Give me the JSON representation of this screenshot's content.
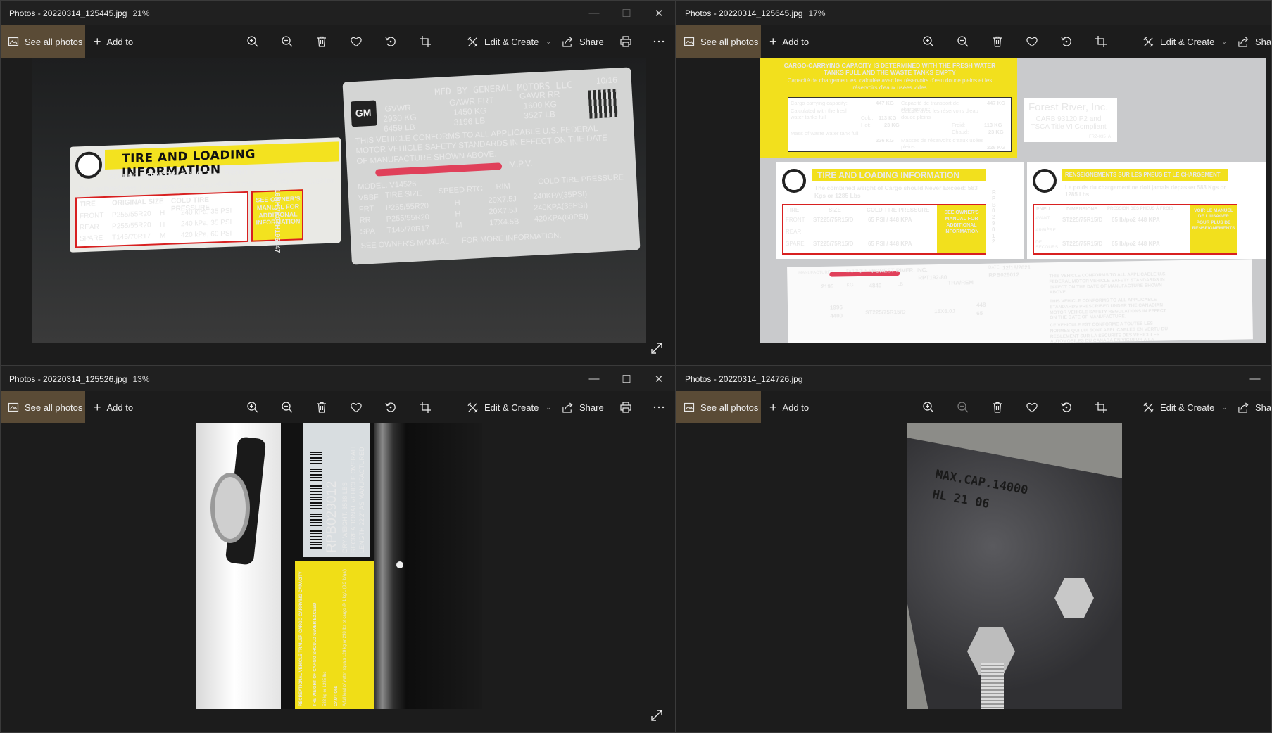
{
  "windows": [
    {
      "title": "Photos - 20220314_125445.jpg",
      "zoom": "21%",
      "toolbar": {
        "see_all": "See all photos",
        "add_to": "Add to",
        "edit_create": "Edit & Create",
        "share": "Share"
      },
      "photo": {
        "tire_header": "TIRE AND LOADING INFORMATION",
        "seating": "SEATING CAPACITY",
        "total": "TOTAL 7",
        "front": "FRONT 2",
        "rear": "REAR 5",
        "combined": "The combined weight of occupants and cargo should never exceed  584 kg or 1288 lbs.",
        "col_tire": "TIRE",
        "col_orig": "ORIGINAL SIZE",
        "col_cold": "COLD TIRE PRESSURE",
        "see_owner": "SEE OWNER'S MANUAL FOR ADDITIONAL INFORMATION",
        "rows": [
          {
            "pos": "FRONT",
            "size": "P255/55R20",
            "rt": "H",
            "p": "240 kPa, 35 PSI"
          },
          {
            "pos": "REAR",
            "size": "P255/55R20",
            "rt": "H",
            "p": "240 kPa, 35 PSI"
          },
          {
            "pos": "SPARE",
            "size": "T145/70R17",
            "rt": "M",
            "p": "420 kPa, 60 PSI"
          }
        ],
        "vin_side": "16NKVK07H196547",
        "gm": "GM",
        "mfd": "MFD BY GENERAL MOTORS LLC",
        "date": "10/16",
        "gvwr": "GVWR",
        "gawr_frt": "GAWR FRT",
        "gawr_rr": "GAWR RR",
        "kg1": "2930 KG",
        "lb1": "6459 LB",
        "kg2": "1450 KG",
        "lb2": "3196 LB",
        "kg3": "1600 KG",
        "lb3": "3527 LB",
        "conform": "THIS VEHICLE CONFORMS TO ALL APPLICABLE U.S. FEDERAL MOTOR VEHICLE SAFETY STANDARDS IN EFFECT ON THE DATE OF MANUFACTURE SHOWN ABOVE.",
        "type": "M.P.V.",
        "model": "MODEL: V14526",
        "vbbf": "VBBF",
        "tire_size": "TIRE SIZE",
        "speed_rtg": "SPEED RTG",
        "rim": "RIM",
        "cold": "COLD TIRE PRESSURE",
        "spec_rows": [
          {
            "pos": "FRT",
            "size": "P255/55R20",
            "rt": "H",
            "rim": "20X7.5J",
            "p": "240KPA(35PSI)"
          },
          {
            "pos": "RR",
            "size": "P255/55R20",
            "rt": "H",
            "rim": "20X7.5J",
            "p": "240KPA(35PSI)"
          },
          {
            "pos": "SPA",
            "size": "T145/70R17",
            "rt": "M",
            "rim": "17X4.5B",
            "p": "420KPA(60PSI)"
          }
        ],
        "see_more": "SEE OWNER'S MANUAL      FOR MORE INFORMATION."
      }
    },
    {
      "title": "Photos - 20220314_125645.jpg",
      "zoom": "17%",
      "toolbar": {
        "see_all": "See all photos",
        "add_to": "Add to",
        "edit_create": "Edit & Create",
        "share": "Shar"
      },
      "photo": {
        "top_text": "CARGO-CARRYING CAPACITY IS DETERMINED WITH THE FRESH WATER TANKS FULL AND THE WASTE TANKS EMPTY",
        "fr_text": "Capacité de chargement est calculée avec les réservoirs d'eau douce pleins et les réservoirs d'eaux usées vides",
        "cargo_cap": "Cargo carrying capacity:",
        "cargo_val": "447 KG",
        "cap_fr": "Capacité de transport de chargement:",
        "cap_fr_val": "447 KG",
        "calc": "Calculated with the fresh water tanks full",
        "cold_lbl": "Cold:",
        "cold_val": "113 KG",
        "hot_lbl": "Hot:",
        "hot_val": "23 KG",
        "calc_fr": "Calculé avec les réservoirs d'eau douce pleins",
        "froid": "Froid:",
        "froid_val": "113 KG",
        "chaud": "Chaud:",
        "chaud_val": "23 KG",
        "waste": "Mass of waste water tank full:",
        "waste_val": "226 KG",
        "waste_fr": "Masses de réservoirs d'eaux usées pleins:",
        "waste_fr_val": "226 KG",
        "fr_brand": "Forest River, Inc.",
        "carb": "CARB 93120 P2 and TSCA Title VI Compliant",
        "frz": "FRZ-035_A",
        "tire_header": "TIRE AND LOADING INFORMATION",
        "combined": "The combined weight of Cargo should Never Exceed: 583 Kgs or 1285 Lbs",
        "col_tire": "TIRE",
        "col_size": "SIZE",
        "col_cold": "COLD TIRE PRESSURE",
        "see_owner": "SEE OWNER'S MANUAL FOR ADDITIONAL INFORMATION",
        "rows": [
          {
            "pos": "FRONT",
            "size": "ST225/75R15/D",
            "p": "65 PSI / 448 KPA"
          },
          {
            "pos": "REAR",
            "size": "",
            "p": ""
          },
          {
            "pos": "SPARE",
            "size": "ST225/75R15/D",
            "p": "65 PSI / 448 KPA"
          }
        ],
        "vert": "RPB029012",
        "fr_header": "RENSEIGNEMENTS SUR LES PNEUS ET LE CHARGEMENT",
        "fr_combined": "Le poids du chargement ne doit jamais depasser 583 Kgs or 1285 Lbs",
        "fr_col_pneu": "PNEU",
        "fr_col_dim": "DIMENSIONS",
        "fr_col_pression": "PRESSION DES PNEUS À FROID",
        "fr_see": "VOIR LE MANUEL DE L'USAGER POUR PLUS DE RENSEIGNEMENTS",
        "fr_rows": [
          {
            "pos": "AVANT",
            "size": "ST225/75R15/D",
            "p": "65 lb/po2  448 KPA"
          },
          {
            "pos": "ARRIÈRE",
            "size": "",
            "p": ""
          },
          {
            "pos": "DE SECOURS",
            "size": "ST225/75R15/D",
            "p": "65 lb/po2  448 KPA"
          }
        ],
        "manufactured": "MANUFACTURED",
        "fabrique": "FABRIQUE PAR:",
        "maker": "FOREST RIVER, INC.",
        "date_lbl": "DATE",
        "date": "12/16/2021",
        "vin": "RPT192-80",
        "vin2": "RPB029012",
        "gvwr_kg": "2195",
        "kg": "KG",
        "lb_val": "4840",
        "lb": "LB",
        "type": "TRA/REM",
        "front_kg": "1996",
        "front_lb": "4400",
        "tire": "ST225/75R15/D",
        "rim": "15X6.0J",
        "psi": "448",
        "psi2": "65",
        "conform": "THIS VEHICLE CONFORMS TO ALL APPLICABLE U.S. FEDERAL MOTOR VEHICLE SAFETY STANDARDS IN EFFECT ON THE DATE OF MANUFACTURE SHOWN ABOVE.",
        "conform_ca": "THIS VEHICLE CONFORMS TO ALL APPLICABLE STANDARDS PRESCRIBED UNDER THE CANADIAN MOTOR VEHICLE SAFETY REGULATIONS IN EFFECT ON THE DATE OF MANUFACTURE.",
        "conform_fr": "CE VEHICULE EST CONFORME A TOUTES LES NORMES QUI LUI SONT APPLICABLES EN VERTU DU REGLEMENT SUR LA SECURITE DES VEHICULES AUTOMOBILES DU CANADA EN VIGUEUR A LA"
      }
    },
    {
      "title": "Photos - 20220314_125526.jpg",
      "zoom": "13%",
      "toolbar": {
        "see_all": "See all photos",
        "add_to": "Add to",
        "edit_create": "Edit & Create",
        "share": "Share"
      },
      "photo": {
        "vin": "RPB029012",
        "dry": "DRY WEIGHT: 3538 LBS",
        "rec": "RECREATIONAL VEHICLE OVERALL",
        "length": "LENGTH 22'2\" AS MANUFACTURED",
        "yellow1": "RECREATIONAL VEHICLE TRAILER CARGO CARRYING CAPACITY",
        "yellow2": "THE WEIGHT OF CARGO SHOULD NEVER EXCEED",
        "yellow3": "583 kg or 1285 lbs",
        "caution": "CAUTION:",
        "yellow4": "A full load of water equals 128 kg or 298 lbs of cargo @ 1 kg/L (8.3 lb/gal)"
      }
    },
    {
      "title": "Photos - 20220314_124726.jpg",
      "zoom": "",
      "toolbar": {
        "see_all": "See all photos",
        "add_to": "Add to",
        "edit_create": "Edit & Create",
        "share": "Shar"
      },
      "photo": {
        "stamp1": "MAX.CAP.14000",
        "stamp2": "HL 21 06"
      }
    }
  ]
}
